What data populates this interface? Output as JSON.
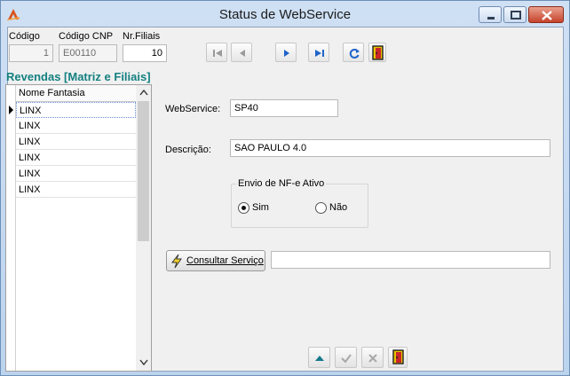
{
  "window": {
    "title": "Status de WebService"
  },
  "header": {
    "codigo_label": "Código",
    "codigo_value": "1",
    "codigo_cnp_label": "Código CNP",
    "codigo_cnp_value": "E00110",
    "nr_filiais_label": "Nr.Filiais",
    "nr_filiais_value": "10"
  },
  "revendas": {
    "title": "Revendas [Matriz e Filiais]",
    "column_header": "Nome Fantasia",
    "rows": [
      "LINX",
      "LINX",
      "LINX",
      "LINX",
      "LINX",
      "LINX"
    ]
  },
  "form": {
    "webservice_label": "WebService:",
    "webservice_value": "SP40",
    "descricao_label": "Descrição:",
    "descricao_value": "SAO PAULO 4.0",
    "nfe_group_label": "Envio de NF-e Ativo",
    "sim_label": "Sim",
    "nao_label": "Não",
    "consultar_label": "Consultar Serviço",
    "consultar_result": ""
  },
  "colors": {
    "section_title": "#148080",
    "nav_icon": "#1f63c9"
  }
}
